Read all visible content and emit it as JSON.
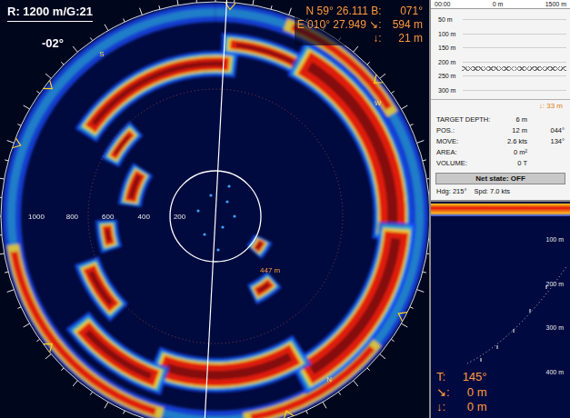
{
  "sonar": {
    "range_gain": "R: 1200 m/G:21",
    "tilt": "-02°",
    "position": [
      {
        "label": "N 59° 26.111 B:",
        "value": "071°"
      },
      {
        "label": "E 010° 27.949 ↘:",
        "value": "594 m"
      },
      {
        "label": "↓:",
        "value": "21 m"
      }
    ],
    "range_labels": [
      "1000",
      "800",
      "600",
      "400",
      "200"
    ],
    "target_label": "447 m",
    "compass": [
      "S",
      "W",
      "N"
    ]
  },
  "depth_chart": {
    "time": "00:00",
    "distance_start": "0 m",
    "distance_end": "1500 m",
    "depth_ticks": [
      "50 m",
      "100 m",
      "150 m",
      "200 m",
      "250 m",
      "300 m"
    ],
    "marker_level": 0.64,
    "depth_readout": "↓: 33 m"
  },
  "target": [
    {
      "label": "TARGET DEPTH:",
      "value": "6 m",
      "extra": ""
    },
    {
      "label": "POS.:",
      "value": "12 m",
      "extra": "044°"
    },
    {
      "label": "MOVE:",
      "value": "2.6 kts",
      "extra": "134°"
    },
    {
      "label": "AREA:",
      "value": "0 m²",
      "extra": ""
    },
    {
      "label": "VOLUME:",
      "value": "0 T",
      "extra": ""
    }
  ],
  "net_button": "Net state: OFF",
  "heading": {
    "hdg": "Hdg: 215°",
    "spd": "Spd: 7.0 kts"
  },
  "echogram": {
    "depth_ticks": [
      "100 m",
      "200 m",
      "300 m",
      "400 m"
    ]
  },
  "tracking": [
    {
      "label": "T:",
      "value": "145°"
    },
    {
      "label": "↘:",
      "value": "0 m"
    },
    {
      "label": "↓:",
      "value": "0 m"
    }
  ]
}
